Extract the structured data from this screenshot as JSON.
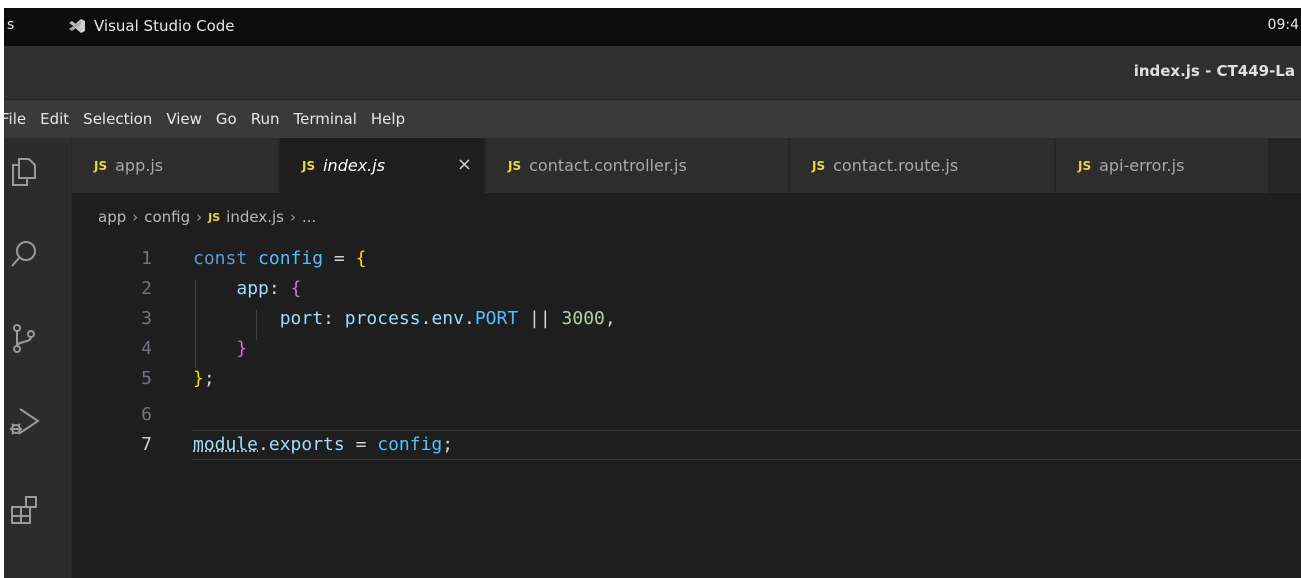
{
  "system_bar": {
    "left_text": "s",
    "app_name": "Visual Studio Code",
    "clock": "09:4"
  },
  "window": {
    "title": "index.js - CT449-La"
  },
  "menu": [
    "File",
    "Edit",
    "Selection",
    "View",
    "Go",
    "Run",
    "Terminal",
    "Help"
  ],
  "activity_icons": [
    "explorer-icon",
    "search-icon",
    "source-control-icon",
    "run-debug-icon",
    "extensions-icon"
  ],
  "tabs": [
    {
      "badge": "JS",
      "label": "app.js",
      "active": false
    },
    {
      "badge": "JS",
      "label": "index.js",
      "active": true,
      "close": "×"
    },
    {
      "badge": "JS",
      "label": "contact.controller.js",
      "active": false
    },
    {
      "badge": "JS",
      "label": "contact.route.js",
      "active": false
    },
    {
      "badge": "JS",
      "label": "api-error.js",
      "active": false
    }
  ],
  "breadcrumb": {
    "parts": [
      "app",
      "config"
    ],
    "file_badge": "JS",
    "file": "index.js",
    "trail": "..."
  },
  "code": {
    "line_numbers": [
      "1",
      "2",
      "3",
      "4",
      "5",
      "6",
      "7"
    ],
    "current_line": 7,
    "l1": {
      "kw": "const",
      "name": "config",
      "op": " = ",
      "brace": "{"
    },
    "l2": {
      "key": "app",
      "colon": ": ",
      "brace": "{"
    },
    "l3": {
      "key": "port",
      "colon": ": ",
      "obj": "process",
      "dot1": ".",
      "env": "env",
      "dot2": ".",
      "const": "PORT",
      "op": " || ",
      "num": "3000",
      "comma": ","
    },
    "l4": {
      "brace": "}"
    },
    "l5": {
      "brace": "}",
      "semi": ";"
    },
    "l7": {
      "mod": "module",
      "dot": ".",
      "exports": "exports",
      "op": " = ",
      "val": "config",
      "semi": ";"
    }
  },
  "colors": {
    "keyword": "#569cd6",
    "variable": "#4fc1ff",
    "property": "#9cdcfe",
    "number": "#b5cea8",
    "js_badge": "#e8d44d"
  }
}
